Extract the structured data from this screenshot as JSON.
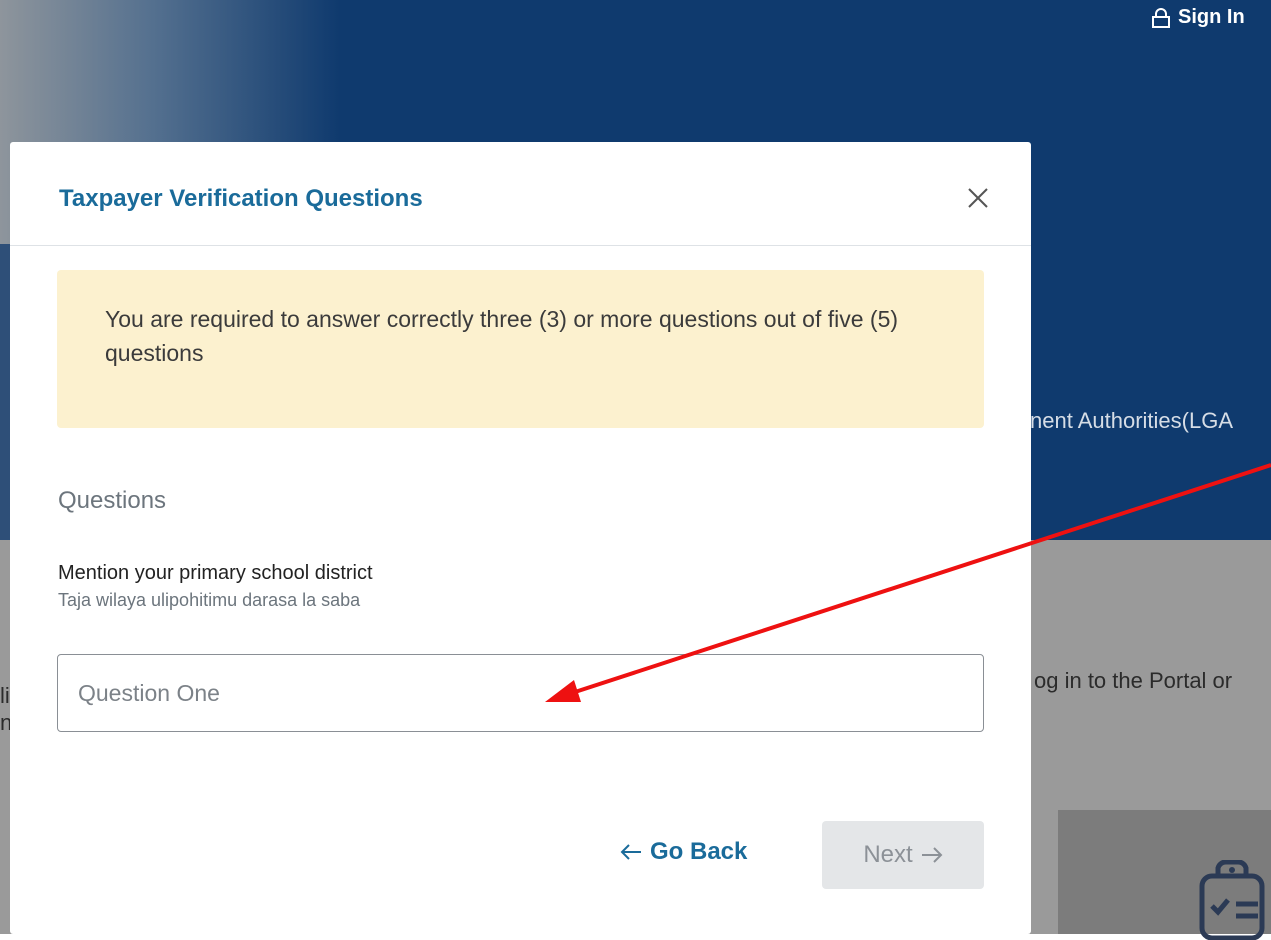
{
  "background": {
    "sign_in_label": "Sign In",
    "lga_fragment": "nent Authorities(LGA",
    "portal_fragment": "og in to the Portal or",
    "left_fragment_1": "li",
    "left_fragment_2": "n"
  },
  "modal": {
    "title": "Taxpayer Verification Questions",
    "close_icon": "close-icon",
    "alert_text": "You are required to answer correctly three (3) or more questions out of five (5) questions",
    "section_label": "Questions",
    "question": {
      "text": "Mention your primary school district",
      "translation": "Taja wilaya ulipohitimu darasa la saba",
      "placeholder": "Question One",
      "value": ""
    },
    "buttons": {
      "go_back": "Go Back",
      "next": "Next"
    }
  },
  "colors": {
    "header_bg": "#0f3a6e",
    "accent": "#1a6b9a",
    "alert_bg": "#fcf1cf",
    "annotation_arrow": "#ee1111"
  }
}
